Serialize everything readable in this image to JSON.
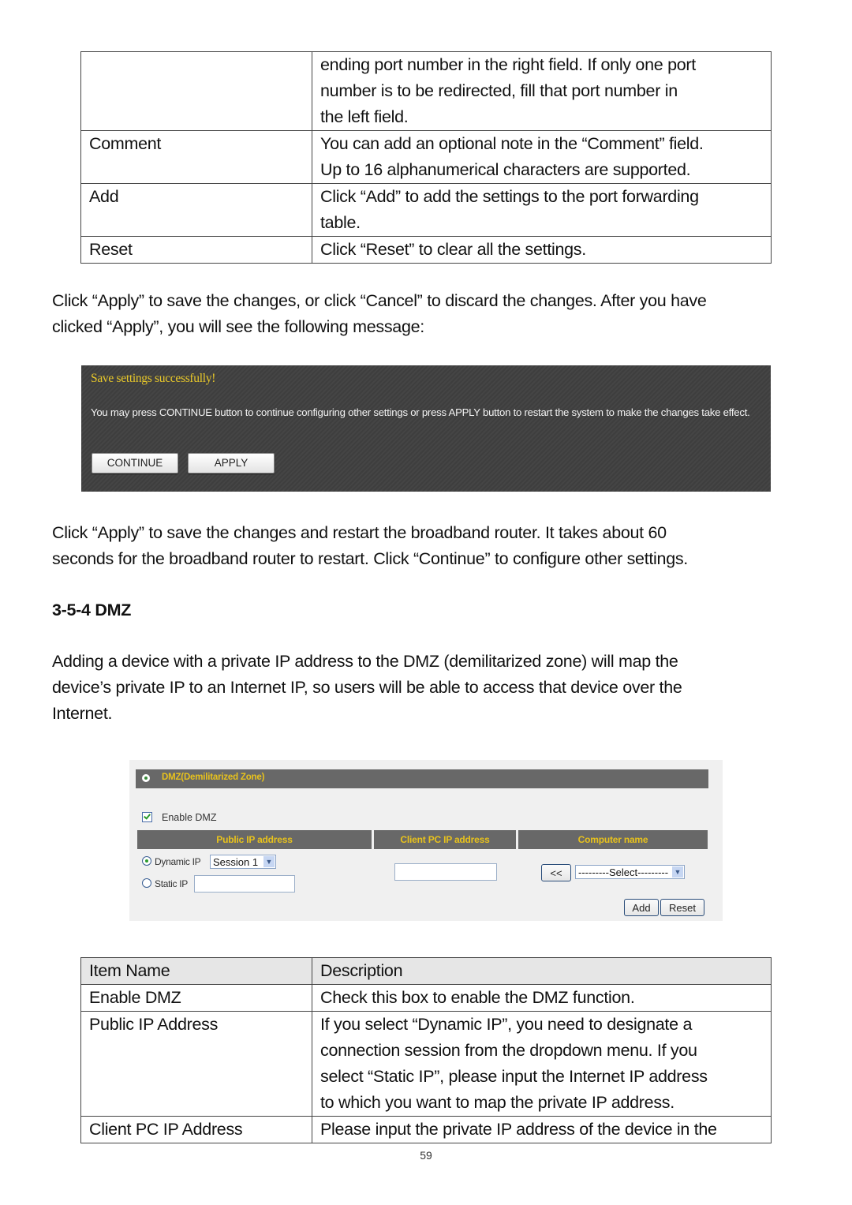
{
  "top_table": {
    "rows": [
      {
        "name": "",
        "desc": [
          "ending port number in the right field. If only one port",
          "number is to be redirected, fill that port number in",
          "the left field."
        ]
      },
      {
        "name": "Comment",
        "desc": [
          "You can add an optional note in the “Comment” field.",
          "Up to 16 alphanumerical characters are supported."
        ]
      },
      {
        "name": "Add",
        "desc": [
          "Click “Add” to add the settings to the port forwarding",
          "table."
        ]
      },
      {
        "name": "Reset",
        "desc": [
          "Click “Reset” to clear all the settings."
        ]
      }
    ]
  },
  "para1": [
    "Click “Apply” to save the changes, or click “Cancel” to discard the changes. After you have",
    "clicked “Apply”, you will see the following message:"
  ],
  "save_dialog": {
    "title": "Save settings successfully!",
    "message": "You may press CONTINUE button to continue configuring other settings or press APPLY button to restart the system to make the changes take effect.",
    "continue_label": "CONTINUE",
    "apply_label": "APPLY",
    "title_color": "#e8c82a"
  },
  "para2": [
    "Click “Apply” to save the changes and restart the broadband router. It takes about 60",
    "seconds for the broadband router to restart. Click “Continue” to configure other settings."
  ],
  "section_heading": "3-5-4 DMZ",
  "para3": [
    "Adding a device with a private IP address to the DMZ (demilitarized zone) will map the",
    "device’s private IP to an Internet IP, so users will be able to access that device over the",
    "Internet."
  ],
  "dmz_panel": {
    "title": "DMZ(Demilitarized Zone)",
    "enable_label": "Enable DMZ",
    "enable_checked": true,
    "col_public": "Public IP address",
    "col_client": "Client PC IP address",
    "col_computer": "Computer name",
    "dynamic_label": "Dynamic IP",
    "static_label": "Static IP",
    "selected_mode": "Dynamic IP",
    "session_value": "Session 1",
    "static_ip_value": "",
    "client_ip_value": "",
    "copy_button": "<<",
    "computer_select": "---------Select---------",
    "add_label": "Add",
    "reset_label": "Reset",
    "header_color": "#686868",
    "header_text_color": "#e8c21c"
  },
  "dmz_table": {
    "header": {
      "name": "Item Name",
      "desc": "Description"
    },
    "rows": [
      {
        "name": "Enable DMZ",
        "desc": [
          "Check this box to enable the DMZ function."
        ]
      },
      {
        "name": "Public IP Address",
        "desc": [
          "If you select “Dynamic IP”, you need to designate a",
          "connection session from the dropdown menu. If you",
          "select “Static IP”, please input the Internet IP address",
          "to which you want to map the private IP address."
        ]
      },
      {
        "name": "Client PC IP Address",
        "desc": [
          "Please input the private IP address of the device in the"
        ]
      }
    ]
  },
  "page_number": "59"
}
